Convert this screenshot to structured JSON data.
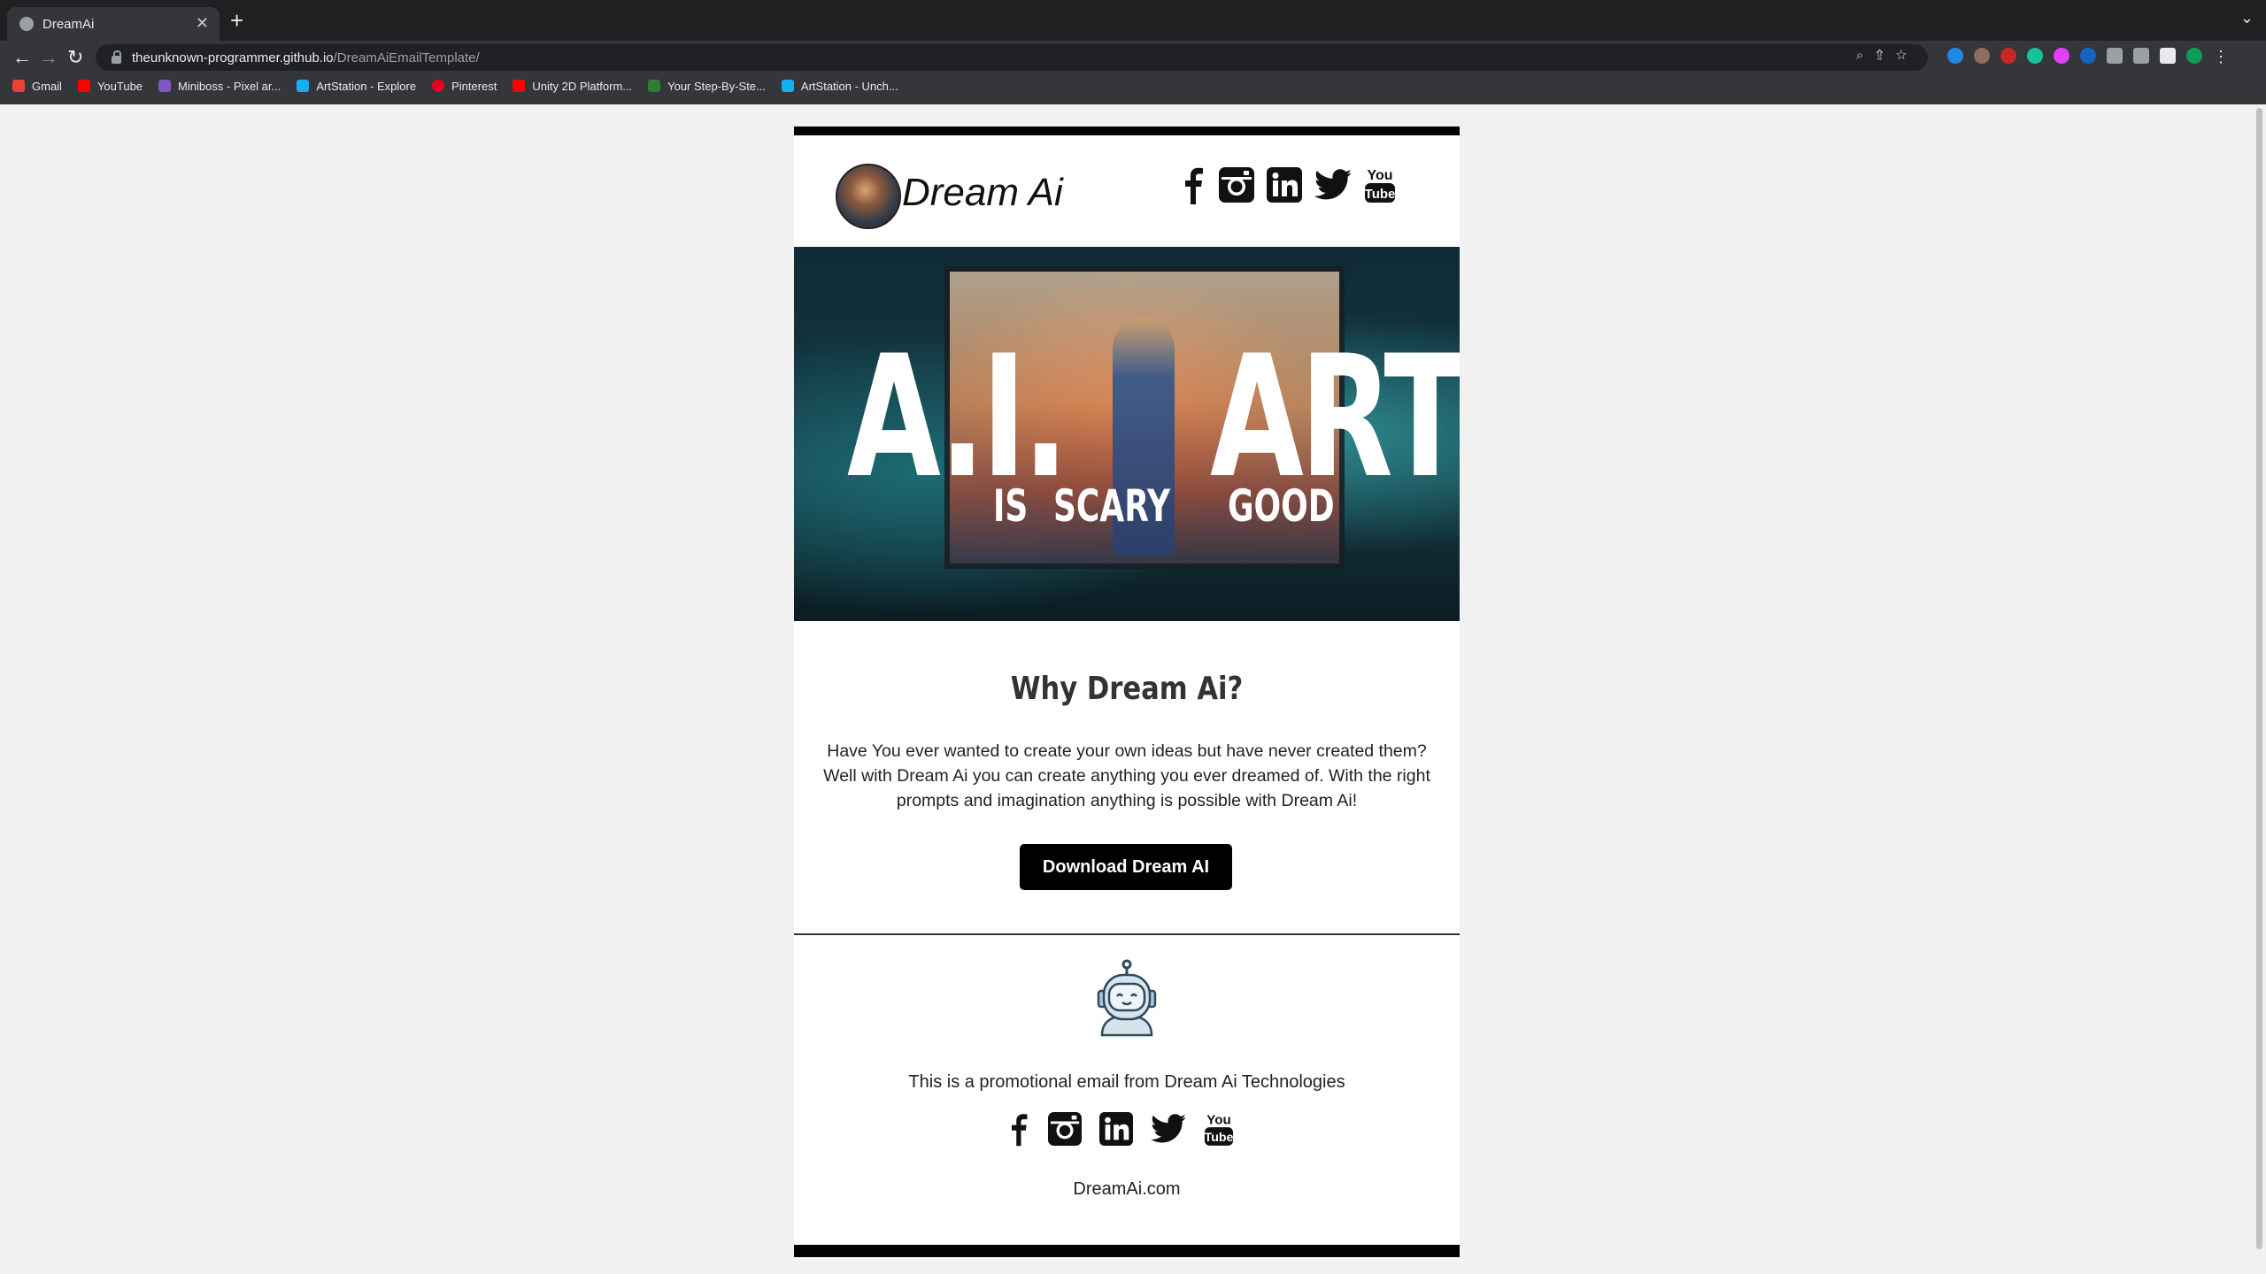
{
  "browser": {
    "tab_title": "DreamAi",
    "tab_close": "✕",
    "new_tab": "+",
    "tab_menu": "⌄",
    "url_host": "theunknown-programmer.github.io",
    "url_path": "/DreamAiEmailTemplate/",
    "nav": {
      "back": "←",
      "forward": "→",
      "reload": "↻"
    },
    "omni_icons": "⌕⇪☆",
    "bookmarks": [
      {
        "label": "Gmail",
        "color": "#ea4335",
        "icon": "gmail-icon"
      },
      {
        "label": "YouTube",
        "color": "#ff0000",
        "icon": "youtube-icon"
      },
      {
        "label": "Miniboss - Pixel ar...",
        "color": "#7e57c2",
        "icon": "miniboss-icon"
      },
      {
        "label": "ArtStation - Explore",
        "color": "#13aff0",
        "icon": "artstation-icon"
      },
      {
        "label": "Pinterest",
        "color": "#e60023",
        "icon": "pinterest-icon"
      },
      {
        "label": "Unity 2D Platform...",
        "color": "#ff0000",
        "icon": "youtube-icon"
      },
      {
        "label": "Your Step-By-Ste...",
        "color": "#2e7d32",
        "icon": "layers-icon"
      },
      {
        "label": "ArtStation - Unch...",
        "color": "#13aff0",
        "icon": "artstation-icon"
      }
    ]
  },
  "email": {
    "brand": "Dream Ai",
    "hero": {
      "big_left": "A.I.",
      "big_right": "ART",
      "small_1": "IS",
      "small_2": "SCARY",
      "small_3": "GOOD"
    },
    "heading": "Why Dream Ai?",
    "body": "Have You ever wanted to create your own ideas but have never created them? Well with Dream Ai you can create anything you ever dreamed of. With the right prompts and imagination anything is possible with Dream Ai!",
    "cta_label": "Download Dream AI",
    "footer_text": "This is a promotional email from Dream Ai Technologies",
    "footer_site": "DreamAi.com",
    "youtube_icon_text": {
      "top": "You",
      "bottom": "Tube"
    }
  }
}
